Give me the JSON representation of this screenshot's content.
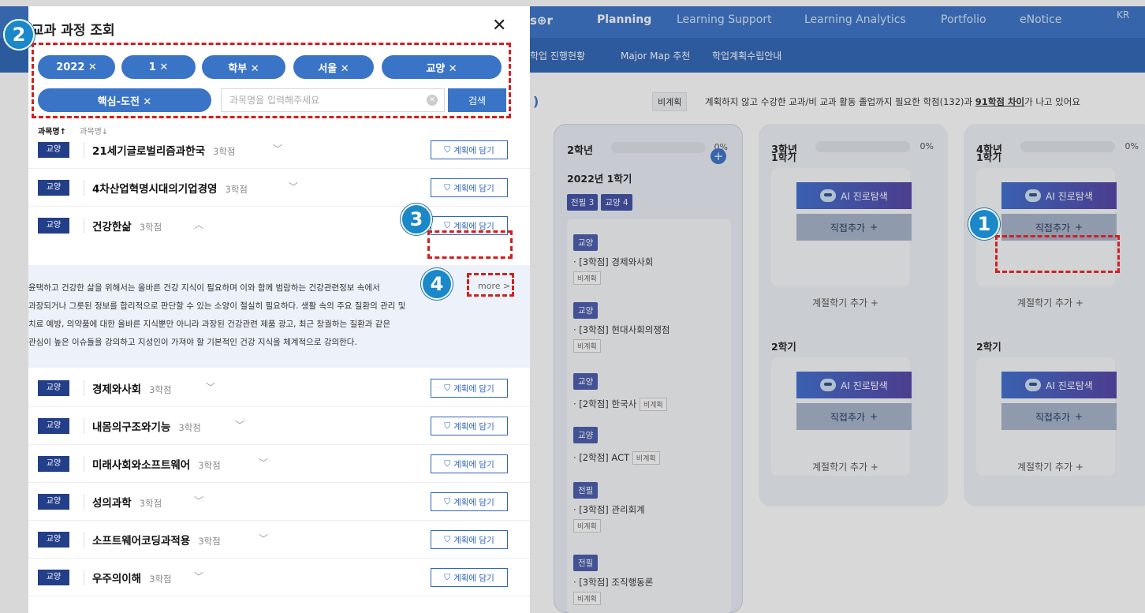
{
  "topbar": {
    "logo": "s⊕r",
    "nav": [
      "Planning",
      "Learning Support",
      "Learning Analytics",
      "Portfolio",
      "eNotice",
      "KR"
    ]
  },
  "subbar": {
    "items": [
      "학업 진행현황",
      "Major Map 추천",
      "학업계획수립안내"
    ]
  },
  "plan_bar": {
    "paren": ")",
    "badge": "비계획",
    "text_a": "계획하지 않고 수강한 교과/비 교과 활동   졸업까지 필요한 학점(132)과 ",
    "text_bold": "91학점 차이",
    "text_b": "가 나고 있어요"
  },
  "year_columns": [
    {
      "year": "2학년",
      "pct": "0%",
      "progress": 0,
      "semester": "2022년 1학기",
      "tags": [
        "전필 3",
        "교양 4"
      ],
      "courses": [
        {
          "tag": "교양",
          "line": "· [3학점] 경제와사회",
          "note": "비계획"
        },
        {
          "tag": "교양",
          "line": "· [3학점] 현대사회의쟁점",
          "note": "비계획"
        },
        {
          "tag": "교양",
          "line": "· [2학점] 한국사",
          "note": "비계획"
        },
        {
          "tag": "교양",
          "line": "· [2학점] ACT",
          "note": "비계획"
        },
        {
          "tag": "전필",
          "line": "· [3학점] 관리회계",
          "note": "비계획"
        },
        {
          "tag": "전필",
          "line": "· [3학점] 조직행동론",
          "note": "비계획"
        }
      ]
    },
    {
      "year": "3학년",
      "pct": "0%",
      "progress": 0,
      "sem1": "1학기",
      "sem2": "2학기"
    },
    {
      "year": "4학년",
      "pct": "0%",
      "progress": 0,
      "sem1": "1학기",
      "sem2": "2학기"
    }
  ],
  "cards": {
    "ai_label": "AI 진로탐색",
    "direct_label": "직접추가",
    "season_label": "계절학기 추가",
    "plus": "+"
  },
  "modal": {
    "title": "교과 과정 조회",
    "close": "✕",
    "chips": [
      "2022 ✕",
      "1 ✕",
      "학부 ✕",
      "서울 ✕",
      "교양 ✕",
      "핵심-도전 ✕"
    ],
    "search_placeholder": "과목명을 입력해주세요",
    "search_button": "검색",
    "sort_asc": "과목명↑",
    "sort_desc": "과목명↓",
    "add_label": "계획에 담기",
    "courses": [
      {
        "tag": "교양",
        "name": "21세기글로벌리즘과한국",
        "credits": "3학점",
        "expanded": false
      },
      {
        "tag": "교양",
        "name": "4차산업혁명시대의기업경영",
        "credits": "3학점",
        "expanded": false
      },
      {
        "tag": "교양",
        "name": "건강한삶",
        "credits": "3학점",
        "expanded": true
      },
      {
        "tag": "교양",
        "name": "경제와사회",
        "credits": "3학점",
        "expanded": false
      },
      {
        "tag": "교양",
        "name": "내몸의구조와기능",
        "credits": "3학점",
        "expanded": false
      },
      {
        "tag": "교양",
        "name": "미래사회와소프트웨어",
        "credits": "3학점",
        "expanded": false
      },
      {
        "tag": "교양",
        "name": "성의과학",
        "credits": "3학점",
        "expanded": false
      },
      {
        "tag": "교양",
        "name": "소프트웨어코딩과적용",
        "credits": "3학점",
        "expanded": false
      },
      {
        "tag": "교양",
        "name": "우주의이해",
        "credits": "3학점",
        "expanded": false
      }
    ],
    "description_lines": [
      "윤택하고 건강한 삶을 위해서는 올바른 건강 지식이 필요하며 이와 함께 범람하는 건강관련정보 속에서",
      "과장되거나 그릇된 정보를 합리적으로 판단할 수 있는 소양이 절실히 필요하다. 생활 속의 주요 질환의 관리 및",
      "치료 예방, 의약품에 대한 올바른 지식뿐만 아니라 과장된 건강관련 제품 광고, 최근 창궐하는 질환과 같은",
      "관심이 높은 이슈들을 강의하고 지성인이 가져야 할 기본적인 건강 지식을 체계적으로 강의한다."
    ],
    "more_label": "more >"
  },
  "annotations": [
    "1",
    "2",
    "3",
    "4"
  ],
  "colors": {
    "primary": "#3a74c6",
    "nav": "#3b73c8",
    "annotation": "#d02020",
    "badge": "#1a88c9"
  }
}
